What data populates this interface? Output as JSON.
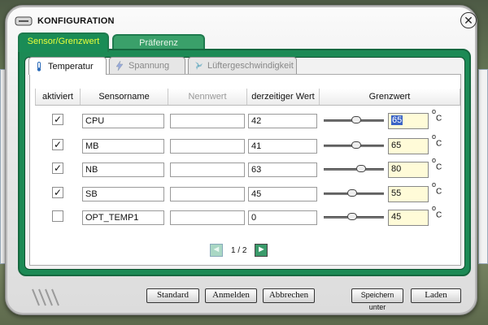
{
  "window": {
    "title": "KONFIGURATION"
  },
  "outer_tabs": [
    {
      "label": "Sensor/Grenzwert",
      "active": true
    },
    {
      "label": "Präferenz",
      "active": false
    }
  ],
  "inner_tabs": [
    {
      "label": "Temperatur",
      "icon": "thermometer-icon",
      "active": true
    },
    {
      "label": "Spannung",
      "icon": "lightning-icon",
      "active": false
    },
    {
      "label": "Lüftergeschwindigkeit",
      "icon": "fan-icon",
      "active": false
    }
  ],
  "columns": [
    "aktiviert",
    "Sensorname",
    "Nennwert",
    "derzeitiger Wert",
    "Grenzwert"
  ],
  "unit": {
    "deg": "o",
    "letter": "C"
  },
  "rows": [
    {
      "enabled": true,
      "check": "✓",
      "name": "CPU",
      "nominal": "",
      "current": "42",
      "limit": "65",
      "slider": 0.55
    },
    {
      "enabled": true,
      "check": "✓",
      "name": "MB",
      "nominal": "",
      "current": "41",
      "limit": "65",
      "slider": 0.55
    },
    {
      "enabled": true,
      "check": "✓",
      "name": "NB",
      "nominal": "",
      "current": "63",
      "limit": "80",
      "slider": 0.65
    },
    {
      "enabled": true,
      "check": "✓",
      "name": "SB",
      "nominal": "",
      "current": "45",
      "limit": "55",
      "slider": 0.47
    },
    {
      "enabled": false,
      "check": "",
      "name": "OPT_TEMP1",
      "nominal": "",
      "current": "0",
      "limit": "45",
      "slider": 0.47
    }
  ],
  "pager": {
    "prev": "◄",
    "next": "►",
    "label": "1 / 2"
  },
  "buttons": {
    "standard": "Standard",
    "apply": "Anmelden",
    "cancel": "Abbrechen",
    "save_as": "Speichern unter",
    "load": "Laden"
  },
  "colors": {
    "accent_green": "#1a8c56",
    "active_tab_text": "#e8ff3a",
    "limit_bg": "#fffbd8"
  }
}
